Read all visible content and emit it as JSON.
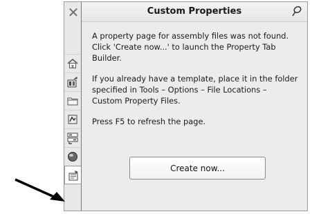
{
  "panel": {
    "title": "Custom Properties",
    "paragraphs": [
      "A property page for assembly files was not found. Click 'Create now...' to launch the Property Tab Builder.",
      "If you already have a template, place it in the folder specified in Tools – Options – File Locations – Custom Property Files.",
      "Press F5 to refresh the page."
    ],
    "create_button": "Create now..."
  },
  "strip": {
    "close_glyph": "✕",
    "tabs": [
      {
        "icon": "home-icon"
      },
      {
        "icon": "design-library-icon"
      },
      {
        "icon": "folder-icon"
      },
      {
        "icon": "view-palette-icon"
      },
      {
        "icon": "appearances-icon"
      },
      {
        "icon": "globe-icon"
      },
      {
        "icon": "custom-properties-icon",
        "active": true
      }
    ]
  },
  "colors": {
    "panel_bg": "#ececec",
    "border": "#9a9a9a"
  }
}
